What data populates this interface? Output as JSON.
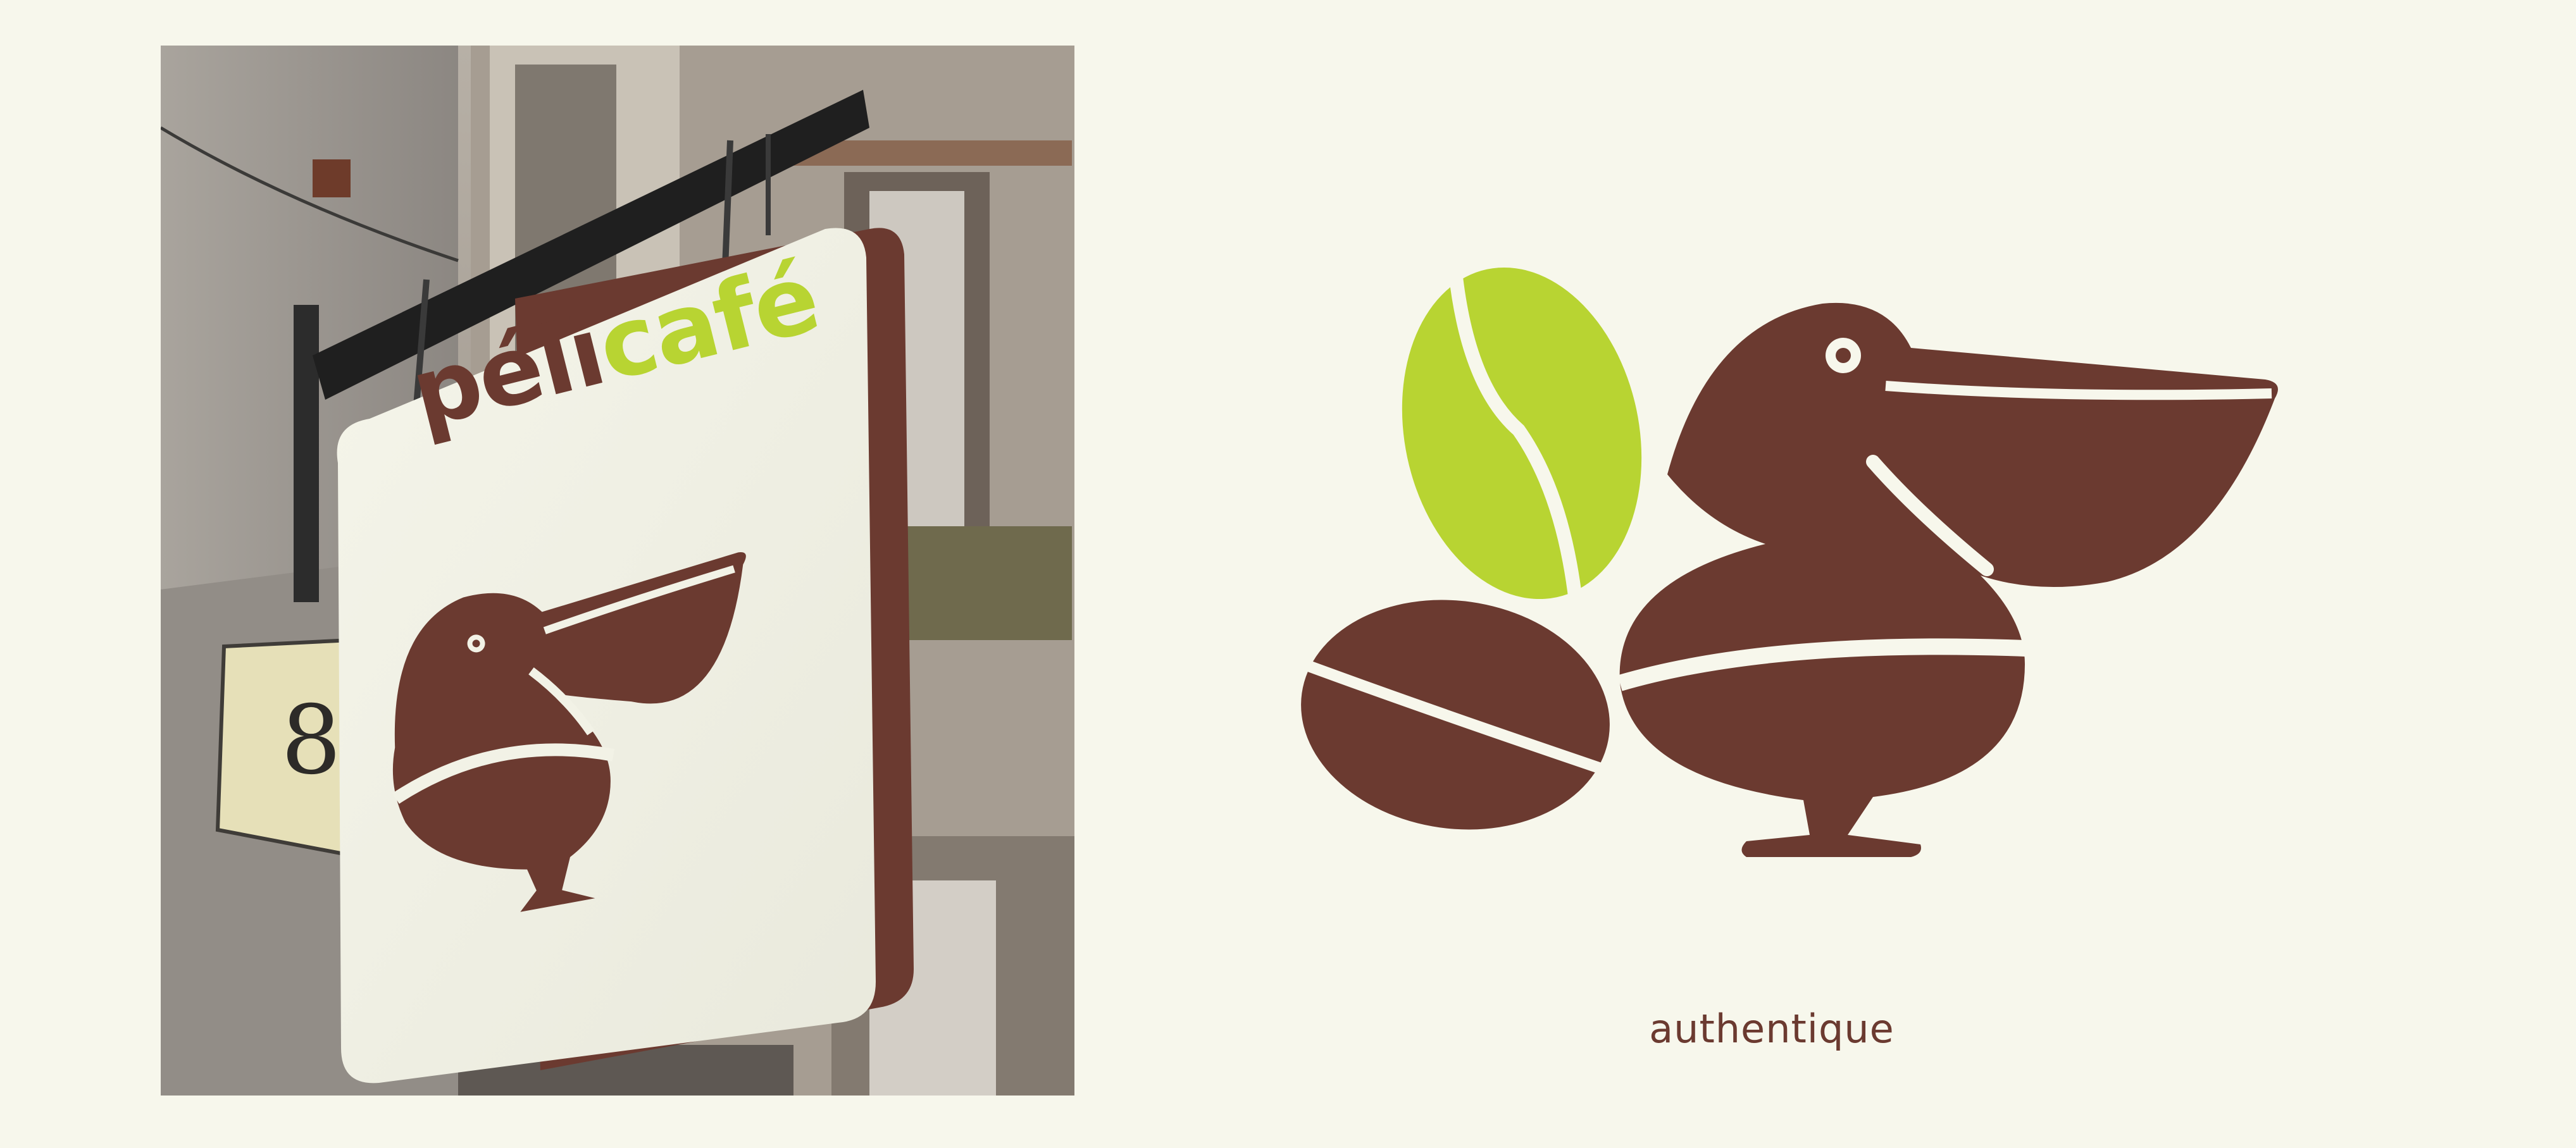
{
  "sign": {
    "brand_part1": "péli",
    "brand_part2": "café",
    "house_number": "8"
  },
  "logo": {
    "tagline": "authentique"
  },
  "colors": {
    "background": "#f7f7ec",
    "brown": "#6b3a30",
    "green": "#b8d432",
    "sign_face": "#f2f2e6"
  },
  "icons": [
    "pelican-coffee-bean-icon",
    "green-coffee-bean-icon",
    "brown-coffee-bean-icon"
  ]
}
